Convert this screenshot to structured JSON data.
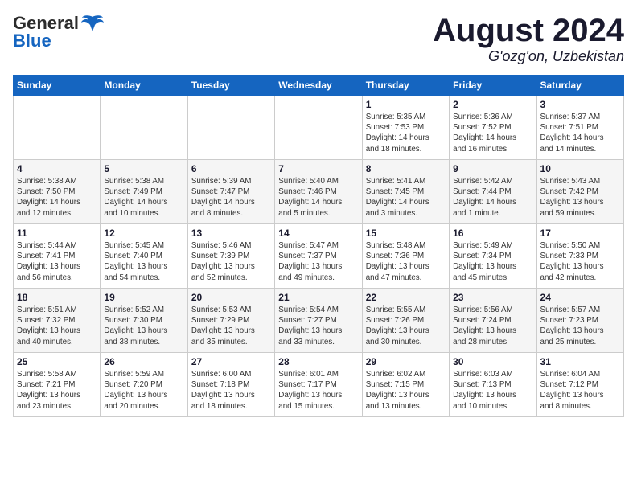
{
  "header": {
    "logo_general": "General",
    "logo_blue": "Blue",
    "month_title": "August 2024",
    "location": "G'ozg'on, Uzbekistan"
  },
  "weekdays": [
    "Sunday",
    "Monday",
    "Tuesday",
    "Wednesday",
    "Thursday",
    "Friday",
    "Saturday"
  ],
  "weeks": [
    [
      {
        "day": "",
        "info": ""
      },
      {
        "day": "",
        "info": ""
      },
      {
        "day": "",
        "info": ""
      },
      {
        "day": "",
        "info": ""
      },
      {
        "day": "1",
        "info": "Sunrise: 5:35 AM\nSunset: 7:53 PM\nDaylight: 14 hours\nand 18 minutes."
      },
      {
        "day": "2",
        "info": "Sunrise: 5:36 AM\nSunset: 7:52 PM\nDaylight: 14 hours\nand 16 minutes."
      },
      {
        "day": "3",
        "info": "Sunrise: 5:37 AM\nSunset: 7:51 PM\nDaylight: 14 hours\nand 14 minutes."
      }
    ],
    [
      {
        "day": "4",
        "info": "Sunrise: 5:38 AM\nSunset: 7:50 PM\nDaylight: 14 hours\nand 12 minutes."
      },
      {
        "day": "5",
        "info": "Sunrise: 5:38 AM\nSunset: 7:49 PM\nDaylight: 14 hours\nand 10 minutes."
      },
      {
        "day": "6",
        "info": "Sunrise: 5:39 AM\nSunset: 7:47 PM\nDaylight: 14 hours\nand 8 minutes."
      },
      {
        "day": "7",
        "info": "Sunrise: 5:40 AM\nSunset: 7:46 PM\nDaylight: 14 hours\nand 5 minutes."
      },
      {
        "day": "8",
        "info": "Sunrise: 5:41 AM\nSunset: 7:45 PM\nDaylight: 14 hours\nand 3 minutes."
      },
      {
        "day": "9",
        "info": "Sunrise: 5:42 AM\nSunset: 7:44 PM\nDaylight: 14 hours\nand 1 minute."
      },
      {
        "day": "10",
        "info": "Sunrise: 5:43 AM\nSunset: 7:42 PM\nDaylight: 13 hours\nand 59 minutes."
      }
    ],
    [
      {
        "day": "11",
        "info": "Sunrise: 5:44 AM\nSunset: 7:41 PM\nDaylight: 13 hours\nand 56 minutes."
      },
      {
        "day": "12",
        "info": "Sunrise: 5:45 AM\nSunset: 7:40 PM\nDaylight: 13 hours\nand 54 minutes."
      },
      {
        "day": "13",
        "info": "Sunrise: 5:46 AM\nSunset: 7:39 PM\nDaylight: 13 hours\nand 52 minutes."
      },
      {
        "day": "14",
        "info": "Sunrise: 5:47 AM\nSunset: 7:37 PM\nDaylight: 13 hours\nand 49 minutes."
      },
      {
        "day": "15",
        "info": "Sunrise: 5:48 AM\nSunset: 7:36 PM\nDaylight: 13 hours\nand 47 minutes."
      },
      {
        "day": "16",
        "info": "Sunrise: 5:49 AM\nSunset: 7:34 PM\nDaylight: 13 hours\nand 45 minutes."
      },
      {
        "day": "17",
        "info": "Sunrise: 5:50 AM\nSunset: 7:33 PM\nDaylight: 13 hours\nand 42 minutes."
      }
    ],
    [
      {
        "day": "18",
        "info": "Sunrise: 5:51 AM\nSunset: 7:32 PM\nDaylight: 13 hours\nand 40 minutes."
      },
      {
        "day": "19",
        "info": "Sunrise: 5:52 AM\nSunset: 7:30 PM\nDaylight: 13 hours\nand 38 minutes."
      },
      {
        "day": "20",
        "info": "Sunrise: 5:53 AM\nSunset: 7:29 PM\nDaylight: 13 hours\nand 35 minutes."
      },
      {
        "day": "21",
        "info": "Sunrise: 5:54 AM\nSunset: 7:27 PM\nDaylight: 13 hours\nand 33 minutes."
      },
      {
        "day": "22",
        "info": "Sunrise: 5:55 AM\nSunset: 7:26 PM\nDaylight: 13 hours\nand 30 minutes."
      },
      {
        "day": "23",
        "info": "Sunrise: 5:56 AM\nSunset: 7:24 PM\nDaylight: 13 hours\nand 28 minutes."
      },
      {
        "day": "24",
        "info": "Sunrise: 5:57 AM\nSunset: 7:23 PM\nDaylight: 13 hours\nand 25 minutes."
      }
    ],
    [
      {
        "day": "25",
        "info": "Sunrise: 5:58 AM\nSunset: 7:21 PM\nDaylight: 13 hours\nand 23 minutes."
      },
      {
        "day": "26",
        "info": "Sunrise: 5:59 AM\nSunset: 7:20 PM\nDaylight: 13 hours\nand 20 minutes."
      },
      {
        "day": "27",
        "info": "Sunrise: 6:00 AM\nSunset: 7:18 PM\nDaylight: 13 hours\nand 18 minutes."
      },
      {
        "day": "28",
        "info": "Sunrise: 6:01 AM\nSunset: 7:17 PM\nDaylight: 13 hours\nand 15 minutes."
      },
      {
        "day": "29",
        "info": "Sunrise: 6:02 AM\nSunset: 7:15 PM\nDaylight: 13 hours\nand 13 minutes."
      },
      {
        "day": "30",
        "info": "Sunrise: 6:03 AM\nSunset: 7:13 PM\nDaylight: 13 hours\nand 10 minutes."
      },
      {
        "day": "31",
        "info": "Sunrise: 6:04 AM\nSunset: 7:12 PM\nDaylight: 13 hours\nand 8 minutes."
      }
    ]
  ]
}
